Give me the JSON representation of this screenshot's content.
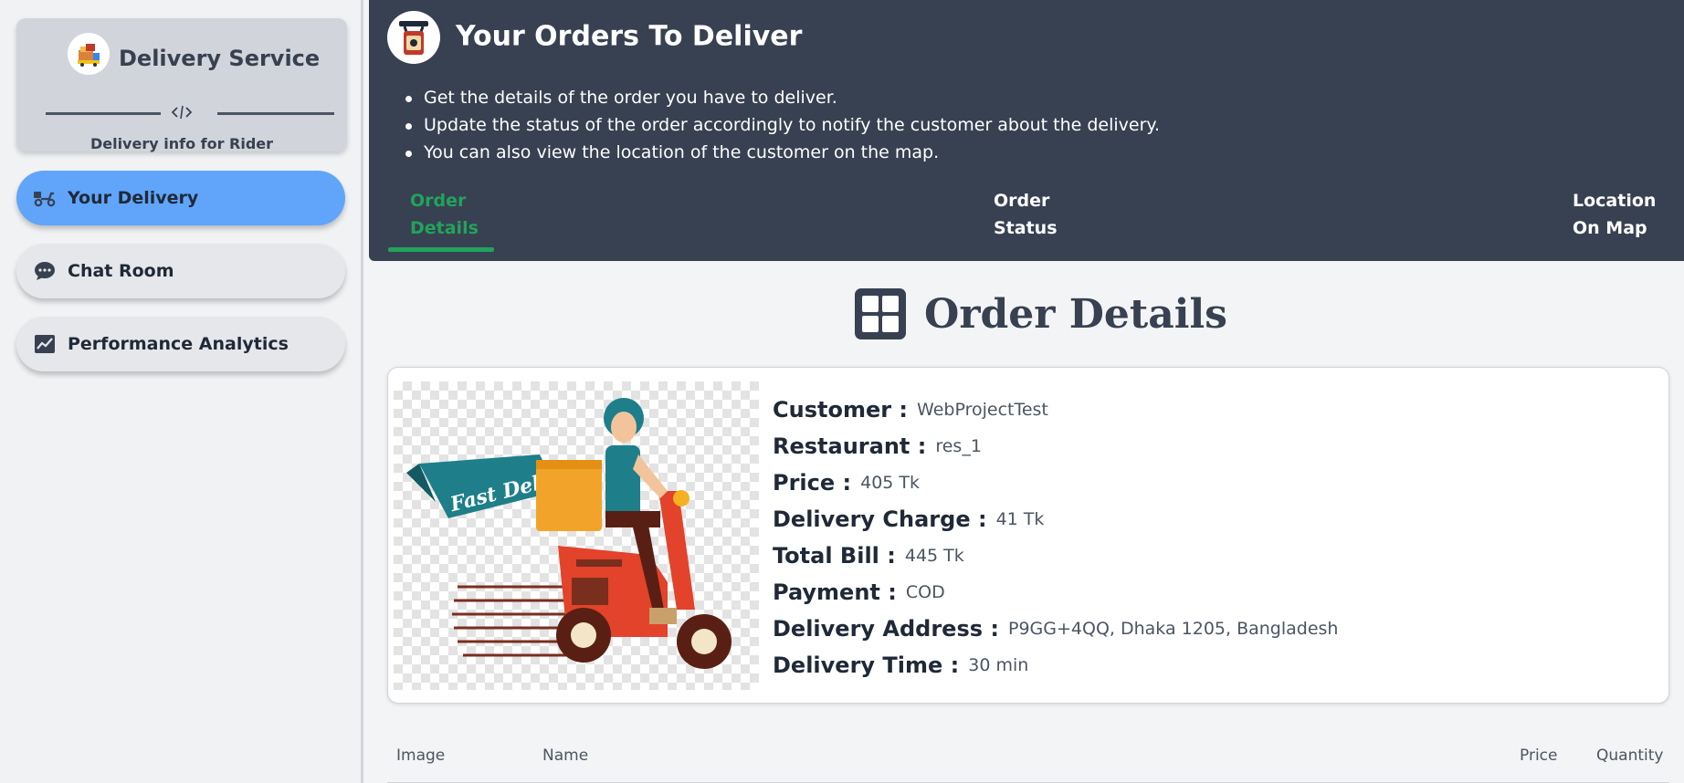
{
  "sidebar": {
    "brand_title": "Delivery Service",
    "brand_subtitle": "Delivery info for Rider",
    "items": [
      {
        "label": "Your Delivery",
        "icon": "scooter-icon",
        "active": true
      },
      {
        "label": "Chat Room",
        "icon": "chat-bubble-icon",
        "active": false
      },
      {
        "label": "Performance Analytics",
        "icon": "chart-line-icon",
        "active": false
      }
    ]
  },
  "header": {
    "title": "Your Orders To Deliver",
    "bullets": [
      "Get the details of the order you have to deliver.",
      "Update the status of the order accordingly to notify the customer about the delivery.",
      "You can also view the location of the customer on the map."
    ],
    "tabs": [
      {
        "line1": "Order",
        "line2": "Details",
        "active": true
      },
      {
        "line1": "Order",
        "line2": "Status",
        "active": false
      },
      {
        "line1": "Location",
        "line2": "On Map",
        "active": false
      }
    ]
  },
  "main": {
    "heading": "Order Details",
    "image_caption": "Fast Delivery",
    "details": [
      {
        "label": "Customer :",
        "value": "WebProjectTest"
      },
      {
        "label": "Restaurant :",
        "value": "res_1"
      },
      {
        "label": "Price :",
        "value": "405 Tk"
      },
      {
        "label": "Delivery Charge :",
        "value": "41 Tk"
      },
      {
        "label": "Total Bill :",
        "value": "445 Tk"
      },
      {
        "label": "Payment :",
        "value": "COD"
      },
      {
        "label": "Delivery Address :",
        "value": "P9GG+4QQ, Dhaka 1205, Bangladesh"
      },
      {
        "label": "Delivery Time :",
        "value": "30 min"
      }
    ],
    "table_headers": [
      "Image",
      "Name",
      "Price",
      "Quantity"
    ]
  },
  "colors": {
    "header_bg": "#374151",
    "active_nav": "#60a5fa",
    "active_tab": "#22a35b",
    "sidebar_bg": "#f1f2f4"
  }
}
